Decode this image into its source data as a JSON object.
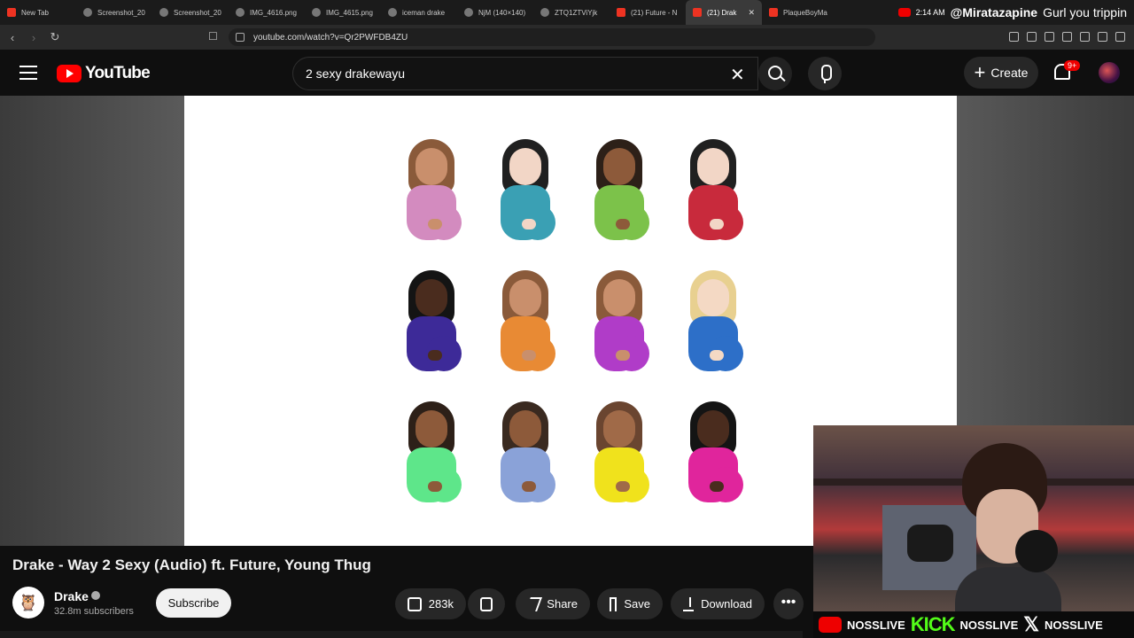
{
  "browser": {
    "tabs": [
      {
        "label": "New Tab",
        "favicon": "youtube-icon"
      },
      {
        "label": "Screenshot_20",
        "favicon": "globe-icon"
      },
      {
        "label": "Screenshot_20",
        "favicon": "globe-icon"
      },
      {
        "label": "IMG_4616.png",
        "favicon": "globe-icon"
      },
      {
        "label": "IMG_4615.png",
        "favicon": "globe-icon"
      },
      {
        "label": "iceman drake",
        "favicon": "globe-icon"
      },
      {
        "label": "NjM (140×140)",
        "favicon": "globe-icon"
      },
      {
        "label": "ZTQ1ZTViYjk",
        "favicon": "globe-icon"
      },
      {
        "label": "(21) Future - N",
        "favicon": "youtube-icon"
      },
      {
        "label": "(21) Drak",
        "favicon": "youtube-icon",
        "active": true
      },
      {
        "label": "PlaqueBoyMa",
        "favicon": "youtube-icon"
      }
    ],
    "url": "youtube.com/watch?v=Qr2PWFDB4ZU"
  },
  "stream_overlay": {
    "time": "2:14 AM",
    "chat_user": "@Miratazapine",
    "chat_message": "Gurl you trippin",
    "handles": [
      "NOSSLIVE",
      "NOSSLIVE",
      "NOSSLIVE"
    ],
    "kick_label": "KICK"
  },
  "youtube": {
    "logo_text": "YouTube",
    "search_query": "2 sexy drakewayu",
    "create_label": "Create",
    "notification_count": "9+"
  },
  "video": {
    "title": "Drake - Way 2 Sexy (Audio) ft. Future, Young Thug",
    "channel": "Drake",
    "subscribers": "32.8m subscribers",
    "subscribe_label": "Subscribe",
    "likes": "283k",
    "share_label": "Share",
    "save_label": "Save",
    "download_label": "Download",
    "more_label": "•••"
  },
  "emoji_figures": [
    {
      "skin": "#c98f6c",
      "hair": "#8a5a3a",
      "shirt": "#d38bbf"
    },
    {
      "skin": "#f2d6c6",
      "hair": "#202020",
      "shirt": "#3aa0b4"
    },
    {
      "skin": "#8d5a3a",
      "hair": "#2d2018",
      "shirt": "#7cc24a"
    },
    {
      "skin": "#f2d6c6",
      "hair": "#202020",
      "shirt": "#c82a3c"
    },
    {
      "skin": "#4a2c1e",
      "hair": "#141414",
      "shirt": "#3d2a98"
    },
    {
      "skin": "#c98f6c",
      "hair": "#8a5a3a",
      "shirt": "#e88a34"
    },
    {
      "skin": "#c98f6c",
      "hair": "#8a5a3a",
      "shirt": "#b03cc8"
    },
    {
      "skin": "#f4d9c4",
      "hair": "#e8d090",
      "shirt": "#2d6fc8"
    },
    {
      "skin": "#8d5a3a",
      "hair": "#2d2018",
      "shirt": "#5ee68a"
    },
    {
      "skin": "#8d5a3a",
      "hair": "#3a2a20",
      "shirt": "#8aa2d8"
    },
    {
      "skin": "#a06a48",
      "hair": "#6a4530",
      "shirt": "#f0e21c"
    },
    {
      "skin": "#4a2c1e",
      "hair": "#141414",
      "shirt": "#e0259c"
    }
  ]
}
